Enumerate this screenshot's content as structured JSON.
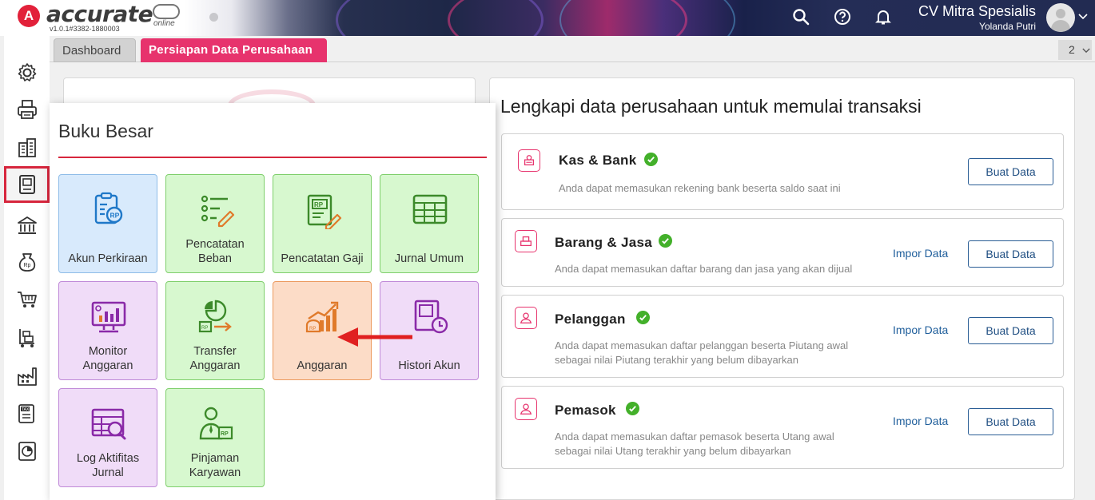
{
  "header": {
    "logo_letter": "A",
    "logo_text": "accurate",
    "logo_sub": "online",
    "version": "v1.0.1#3382-1880003",
    "company": "CV Mitra Spesialis",
    "user": "Yolanda Putri",
    "icons": [
      "search-icon",
      "help-icon",
      "bell-icon"
    ]
  },
  "sidebar": {
    "items": [
      "gear-icon",
      "printer-icon",
      "building-icon",
      "ledger-icon",
      "bank-icon",
      "money-bag-icon",
      "cart-icon",
      "trolley-icon",
      "factory-icon",
      "tax-icon",
      "report-icon"
    ],
    "active_index": 3
  },
  "tabs": [
    {
      "label": "Dashboard"
    },
    {
      "label": "Persiapan Data Perusahaan"
    }
  ],
  "tab_count": "2",
  "main": {
    "title": "Lengkapi data perusahaan untuk memulai transaksi",
    "cards": [
      {
        "title": "Kas & Bank",
        "desc": "Anda dapat memasukan rekening bank beserta saldo saat ini",
        "desc2": "",
        "button": "Buat Data",
        "impor": ""
      },
      {
        "title": "Barang & Jasa",
        "desc": "Anda dapat memasukan daftar barang dan jasa yang akan dijual",
        "desc2": "",
        "button": "Buat Data",
        "impor": "Impor Data"
      },
      {
        "title": "Pelanggan",
        "desc": "Anda dapat memasukan daftar pelanggan beserta Piutang awal",
        "desc2": "sebagai nilai Piutang terakhir yang belum dibayarkan",
        "button": "Buat Data",
        "impor": "Impor Data"
      },
      {
        "title": "Pemasok",
        "desc": "Anda dapat memasukan daftar pemasok beserta Utang awal",
        "desc2": "sebagai nilai Utang terakhir yang belum dibayarkan",
        "button": "Buat Data",
        "impor": "Impor Data"
      }
    ]
  },
  "flyout": {
    "title": "Buku Besar",
    "tiles": [
      {
        "line1": "Akun Perkiraan",
        "line2": "",
        "color": "#d8eafc"
      },
      {
        "line1": "Pencatatan",
        "line2": "Beban",
        "color": "#d7f8cf"
      },
      {
        "line1": "Pencatatan Gaji",
        "line2": "",
        "color": "#d7f8cf"
      },
      {
        "line1": "Jurnal Umum",
        "line2": "",
        "color": "#d7f8cf"
      },
      {
        "line1": "Monitor",
        "line2": "Anggaran",
        "color": "#f0dcf8"
      },
      {
        "line1": "Transfer",
        "line2": "Anggaran",
        "color": "#d7f8cf"
      },
      {
        "line1": "Anggaran",
        "line2": "",
        "color": "#fcdcc7"
      },
      {
        "line1": "Histori Akun",
        "line2": "",
        "color": "#f0dcf8"
      },
      {
        "line1": "Log Aktifitas",
        "line2": "Jurnal",
        "color": "#f0dcf8"
      },
      {
        "line1": "Pinjaman",
        "line2": "Karyawan",
        "color": "#d7f8cf"
      }
    ]
  },
  "colors": {
    "accent": "#e7336d",
    "active_border": "#d7263d",
    "check": "#43b02a",
    "link": "#1f5e9b"
  }
}
